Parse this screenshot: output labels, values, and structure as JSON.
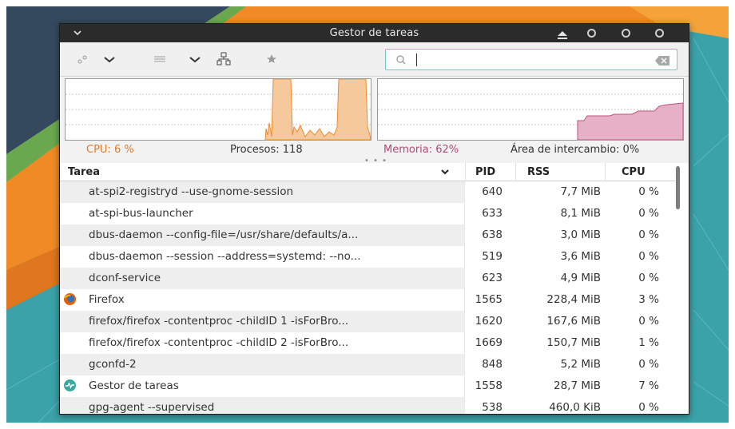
{
  "window": {
    "title": "Gestor de tareas"
  },
  "search": {
    "value": ""
  },
  "graphs": {
    "cpu_label": "CPU: 6 %",
    "processes_label": "Procesos: 118",
    "memory_label": "Memoria: 62%",
    "swap_label": "Área de intercambio: 0%",
    "cpu_color": "#f08a2c",
    "memory_color": "#c0527a"
  },
  "table": {
    "headers": {
      "task": "Tarea",
      "pid": "PID",
      "rss": "RSS",
      "cpu": "CPU"
    },
    "rows": [
      {
        "task": "at-spi2-registryd --use-gnome-session",
        "pid": "640",
        "rss": "7,7 MiB",
        "cpu": "0 %",
        "icon": ""
      },
      {
        "task": "at-spi-bus-launcher",
        "pid": "633",
        "rss": "8,1 MiB",
        "cpu": "0 %",
        "icon": ""
      },
      {
        "task": "dbus-daemon --config-file=/usr/share/defaults/a...",
        "pid": "638",
        "rss": "3,0 MiB",
        "cpu": "0 %",
        "icon": ""
      },
      {
        "task": "dbus-daemon --session --address=systemd: --no...",
        "pid": "519",
        "rss": "3,6 MiB",
        "cpu": "0 %",
        "icon": ""
      },
      {
        "task": "dconf-service",
        "pid": "623",
        "rss": "4,9 MiB",
        "cpu": "0 %",
        "icon": ""
      },
      {
        "task": "Firefox",
        "pid": "1565",
        "rss": "228,4 MiB",
        "cpu": "3 %",
        "icon": "firefox-icon"
      },
      {
        "task": "firefox/firefox -contentproc -childID 1 -isForBro...",
        "pid": "1620",
        "rss": "167,6 MiB",
        "cpu": "0 %",
        "icon": ""
      },
      {
        "task": "firefox/firefox -contentproc -childID 2 -isForBro...",
        "pid": "1669",
        "rss": "150,7 MiB",
        "cpu": "1 %",
        "icon": ""
      },
      {
        "task": "gconfd-2",
        "pid": "848",
        "rss": "5,2 MiB",
        "cpu": "0 %",
        "icon": ""
      },
      {
        "task": "Gestor de tareas",
        "pid": "1558",
        "rss": "28,7 MiB",
        "cpu": "7 %",
        "icon": "task-manager-icon"
      },
      {
        "task": "gpg-agent --supervised",
        "pid": "538",
        "rss": "460,0 KiB",
        "cpu": "0 %",
        "icon": ""
      }
    ]
  }
}
